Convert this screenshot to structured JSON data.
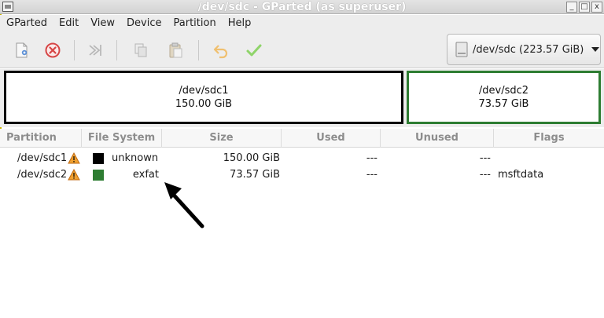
{
  "window": {
    "title": "/dev/sdc - GParted (as superuser)",
    "buttons": [
      "_",
      "□",
      "x"
    ]
  },
  "menu": [
    "GParted",
    "Edit",
    "View",
    "Device",
    "Partition",
    "Help"
  ],
  "toolbar": {
    "icons": [
      "new-icon",
      "delete-icon",
      "resize-move-icon",
      "copy-icon",
      "paste-icon",
      "undo-icon",
      "apply-icon"
    ]
  },
  "device_selector": {
    "label": "/dev/sdc (223.57 GiB)"
  },
  "disk_map": [
    {
      "name": "/dev/sdc1",
      "size": "150.00 GiB",
      "border": "#000000"
    },
    {
      "name": "/dev/sdc2",
      "size": "73.57 GiB",
      "border": "#2e7d32"
    }
  ],
  "table": {
    "columns": [
      "Partition",
      "File System",
      "Size",
      "Used",
      "Unused",
      "Flags"
    ],
    "rows": [
      {
        "partition": "/dev/sdc1",
        "fs_color": "#000000",
        "filesystem": "unknown",
        "size": "150.00 GiB",
        "used": "---",
        "unused": "---",
        "flags": ""
      },
      {
        "partition": "/dev/sdc2",
        "fs_color": "#2e7d32",
        "filesystem": "exfat",
        "size": "73.57 GiB",
        "used": "---",
        "unused": "---",
        "flags": "msftdata"
      }
    ]
  }
}
